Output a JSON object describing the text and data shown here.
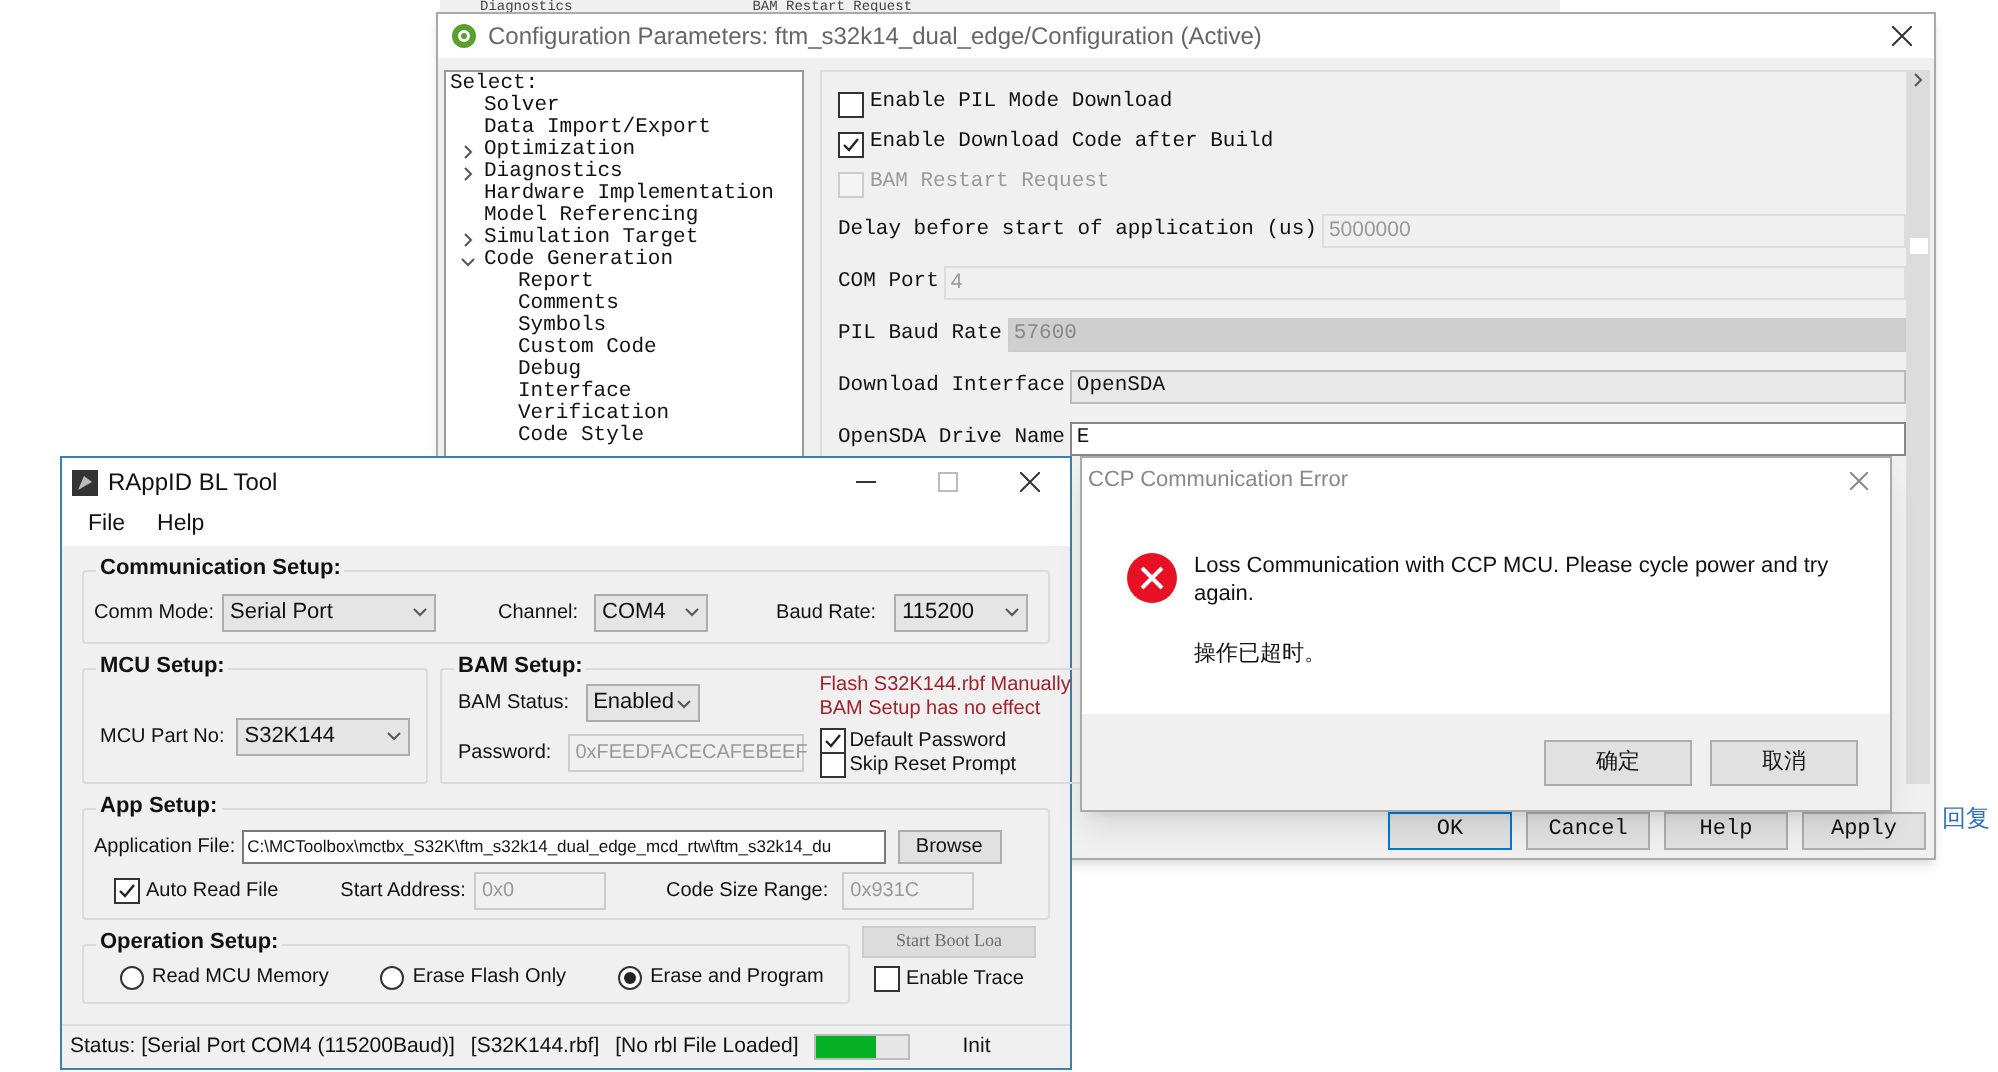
{
  "background_window": {
    "texts": [
      "Diagnostics",
      "BAM Restart Request"
    ]
  },
  "config_window": {
    "title": "Configuration Parameters: ftm_s32k14_dual_edge/Configuration (Active)",
    "tree": {
      "label": "Select:",
      "items": [
        {
          "label": "Solver"
        },
        {
          "label": "Data Import/Export"
        },
        {
          "label": "Optimization",
          "expanded": false
        },
        {
          "label": "Diagnostics",
          "expanded": false
        },
        {
          "label": "Hardware Implementation"
        },
        {
          "label": "Model Referencing"
        },
        {
          "label": "Simulation Target",
          "expanded": false
        },
        {
          "label": "Code Generation",
          "expanded": true,
          "children": [
            {
              "label": "Report"
            },
            {
              "label": "Comments"
            },
            {
              "label": "Symbols"
            },
            {
              "label": "Custom Code"
            },
            {
              "label": "Debug"
            },
            {
              "label": "Interface"
            },
            {
              "label": "Verification"
            },
            {
              "label": "Code Style"
            }
          ]
        }
      ]
    },
    "options": [
      {
        "kind": "checkbox",
        "label": "Enable PIL Mode Download",
        "checked": false,
        "disabled": false
      },
      {
        "kind": "checkbox",
        "label": "Enable Download Code after Build",
        "checked": true,
        "disabled": false
      },
      {
        "kind": "checkbox",
        "label": "BAM Restart Request",
        "checked": false,
        "disabled": true
      },
      {
        "kind": "field",
        "label": "Delay before start of application (us)",
        "value": "5000000",
        "disabled": true
      },
      {
        "kind": "field",
        "label": "COM Port",
        "value": "4",
        "disabled": true
      },
      {
        "kind": "dropdown",
        "label": "PIL Baud Rate",
        "value": "57600",
        "disabled": true
      },
      {
        "kind": "dropdown",
        "label": "Download Interface",
        "value": "OpenSDA",
        "disabled": false
      },
      {
        "kind": "field",
        "label": "OpenSDA Drive Name",
        "value": "E",
        "disabled": false
      }
    ],
    "buttons": [
      {
        "label": "OK",
        "selected": true
      },
      {
        "label": "Cancel",
        "selected": false
      },
      {
        "label": "Help",
        "selected": false
      },
      {
        "label": "Apply",
        "selected": false
      }
    ]
  },
  "bl_tool": {
    "title": "RAppID BL Tool",
    "menu": [
      "File",
      "Help"
    ],
    "communication": {
      "title": "Communication Setup:",
      "fields": [
        {
          "label": "Comm Mode:",
          "value": "Serial Port"
        },
        {
          "label": "Channel:",
          "value": "COM4"
        },
        {
          "label": "Baud Rate:",
          "value": "115200"
        }
      ]
    },
    "mcu": {
      "title": "MCU Setup:",
      "label": "MCU Part No:",
      "value": "S32K144"
    },
    "bam": {
      "title": "BAM Setup:",
      "status_label": "BAM Status:",
      "status_value": "Enabled",
      "password_label": "Password:",
      "password_value": "0xFEEDFACECAFEBEEF",
      "warnings": [
        "Flash S32K144.rbf Manually",
        "BAM Setup has no effect"
      ],
      "checkboxes": [
        {
          "label": "Default Password",
          "checked": true
        },
        {
          "label": "Skip Reset Prompt",
          "checked": false
        }
      ]
    },
    "app": {
      "title": "App Setup:",
      "file_label": "Application File:",
      "file_value": "C:\\MCToolbox\\mctbx_S32K\\ftm_s32k14_dual_edge_mcd_rtw\\ftm_s32k14_du",
      "browse": "Browse",
      "auto_read": {
        "label": "Auto Read File",
        "checked": true
      },
      "start_label": "Start Address:",
      "start_value": "0x0",
      "size_label": "Code Size Range:",
      "size_value": "0x931C"
    },
    "operation": {
      "title": "Operation Setup:",
      "options": [
        {
          "label": "Read MCU Memory",
          "selected": false
        },
        {
          "label": "Erase Flash Only",
          "selected": false
        },
        {
          "label": "Erase and Program",
          "selected": true
        }
      ],
      "start_button": {
        "label": "Start Boot Loa",
        "disabled": true
      },
      "trace": {
        "label": "Enable Trace",
        "checked": false
      }
    },
    "status_bar": {
      "status": "Status: [Serial Port COM4 (115200Baud)]",
      "file": "[S32K144.rbf]",
      "rbl": "[No rbl File Loaded]",
      "level": 0.65,
      "state": "Init"
    }
  },
  "error_dialog": {
    "title": "CCP Communication Error",
    "message": "Loss Communication with CCP MCU. Please cycle power and try again.",
    "detail": "操作已超时。",
    "buttons": [
      "确定",
      "取消"
    ]
  },
  "side_link": "回复"
}
